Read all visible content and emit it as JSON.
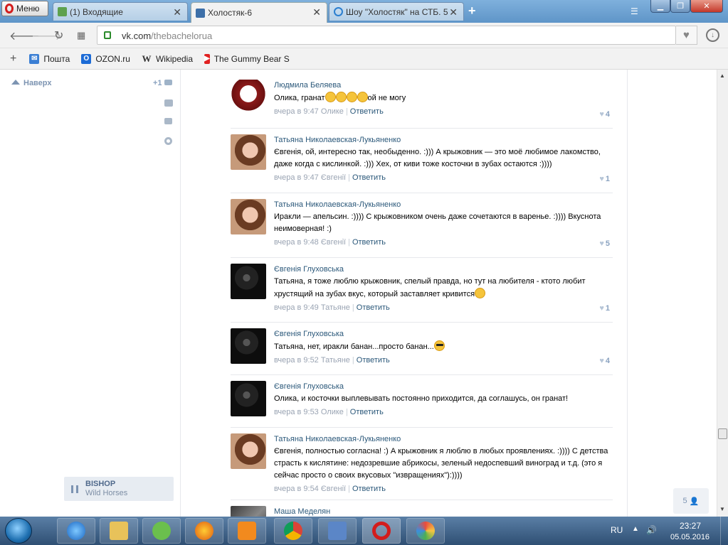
{
  "browser": {
    "menu_label": "Меню",
    "tabs": [
      {
        "label": "(1) Входящие",
        "icon": "mail-tab-icon",
        "active": false
      },
      {
        "label": "Холостяк-6",
        "icon": "video-tab-icon",
        "active": true
      },
      {
        "label": "Шоу \"Холостяк\" на СТБ. 5",
        "icon": "eye-tab-icon",
        "active": false
      }
    ],
    "url_domain": "vk.com",
    "url_path": "/thebachelorua",
    "bookmarks": [
      {
        "label": "Пошта",
        "icon": "mail-icon",
        "color": "#3b7fd4"
      },
      {
        "label": "OZON.ru",
        "icon": "ozon-icon",
        "color": "#1c6bd6"
      },
      {
        "label": "Wikipedia",
        "icon": "wikipedia-icon",
        "color": "#333333"
      },
      {
        "label": "The Gummy Bear Son",
        "icon": "youtube-icon",
        "color": "#e02121"
      }
    ]
  },
  "vk": {
    "to_top": "Наверх",
    "notify_count": "+1",
    "player": {
      "artist": "BISHOP",
      "title": "Wild Horses"
    },
    "friends_online": "5",
    "comments": [
      {
        "author": "Людмила Беляева",
        "text_before": "Олика, гранат",
        "emoji_count": 4,
        "text_after": "ой не могу",
        "time": "вчера в 9:47",
        "to": "Олике",
        "reply": "Ответить",
        "likes": "4",
        "avatar": "cartoon"
      },
      {
        "author": "Татьяна Николаевская-Лукьяненко",
        "text_before": "Євгенія, ой, интересно так, необыденно. :))) А крыжовник — это моё любимое лакомство, даже когда с кислинкой. :))) Хех, от киви тоже косточки в зубах остаются :))))",
        "emoji_count": 0,
        "text_after": "",
        "time": "вчера в 9:47",
        "to": "Євгенії",
        "reply": "Ответить",
        "likes": "1",
        "avatar": "woman"
      },
      {
        "author": "Татьяна Николаевская-Лукьяненко",
        "text_before": "Иракли — апельсин. :)))) С крыжовником очень даже сочетаются в варенье. :)))) Вкуснота неимоверная! :)",
        "emoji_count": 0,
        "text_after": "",
        "time": "вчера в 9:48",
        "to": "Євгенії",
        "reply": "Ответить",
        "likes": "5",
        "avatar": "woman"
      },
      {
        "author": "Євгенія Глуховська",
        "text_before": "Татьяна, я тоже люблю крыжовник, спелый правда, но тут на любителя - ктото любит хрустящий на зубах вкус, который заставляет кривится",
        "emoji_count": 1,
        "text_after": "",
        "time": "вчера в 9:49",
        "to": "Татьяне",
        "reply": "Ответить",
        "likes": "1",
        "avatar": "dark"
      },
      {
        "author": "Євгенія Глуховська",
        "text_before": "Татьяна, нет, иракли банан...просто банан...",
        "emoji_count": 1,
        "text_after": "",
        "time": "вчера в 9:52",
        "to": "Татьяне",
        "reply": "Ответить",
        "likes": "4",
        "avatar": "dark",
        "cool": true
      },
      {
        "author": "Євгенія Глуховська",
        "text_before": "Олика, и косточки выплевывать постоянно приходится, да соглашусь, он гранат!",
        "emoji_count": 0,
        "text_after": "",
        "time": "вчера в 9:53",
        "to": "Олике",
        "reply": "Ответить",
        "likes": "",
        "avatar": "dark"
      },
      {
        "author": "Татьяна Николаевская-Лукьяненко",
        "text_before": "Євгенія, полностью согласна! :) А крыжовник я люблю в любых проявлениях. :)))) С детства страсть к кислятине: недозревшие абрикосы, зеленый недоспевший виноград и т.д. (это я сейчас просто о своих вкусовых \"извращениях\"):))))",
        "emoji_count": 0,
        "text_after": "",
        "time": "вчера в 9:54",
        "to": "Євгенії",
        "reply": "Ответить",
        "likes": "",
        "avatar": "woman"
      },
      {
        "author": "Маша Меделян",
        "text_before": "",
        "emoji_count": 0,
        "text_after": "",
        "time": "",
        "to": "",
        "reply": "",
        "likes": "",
        "avatar": "group"
      }
    ]
  },
  "taskbar": {
    "lang": "RU",
    "time": "23:27",
    "date": "05.05.2016"
  }
}
